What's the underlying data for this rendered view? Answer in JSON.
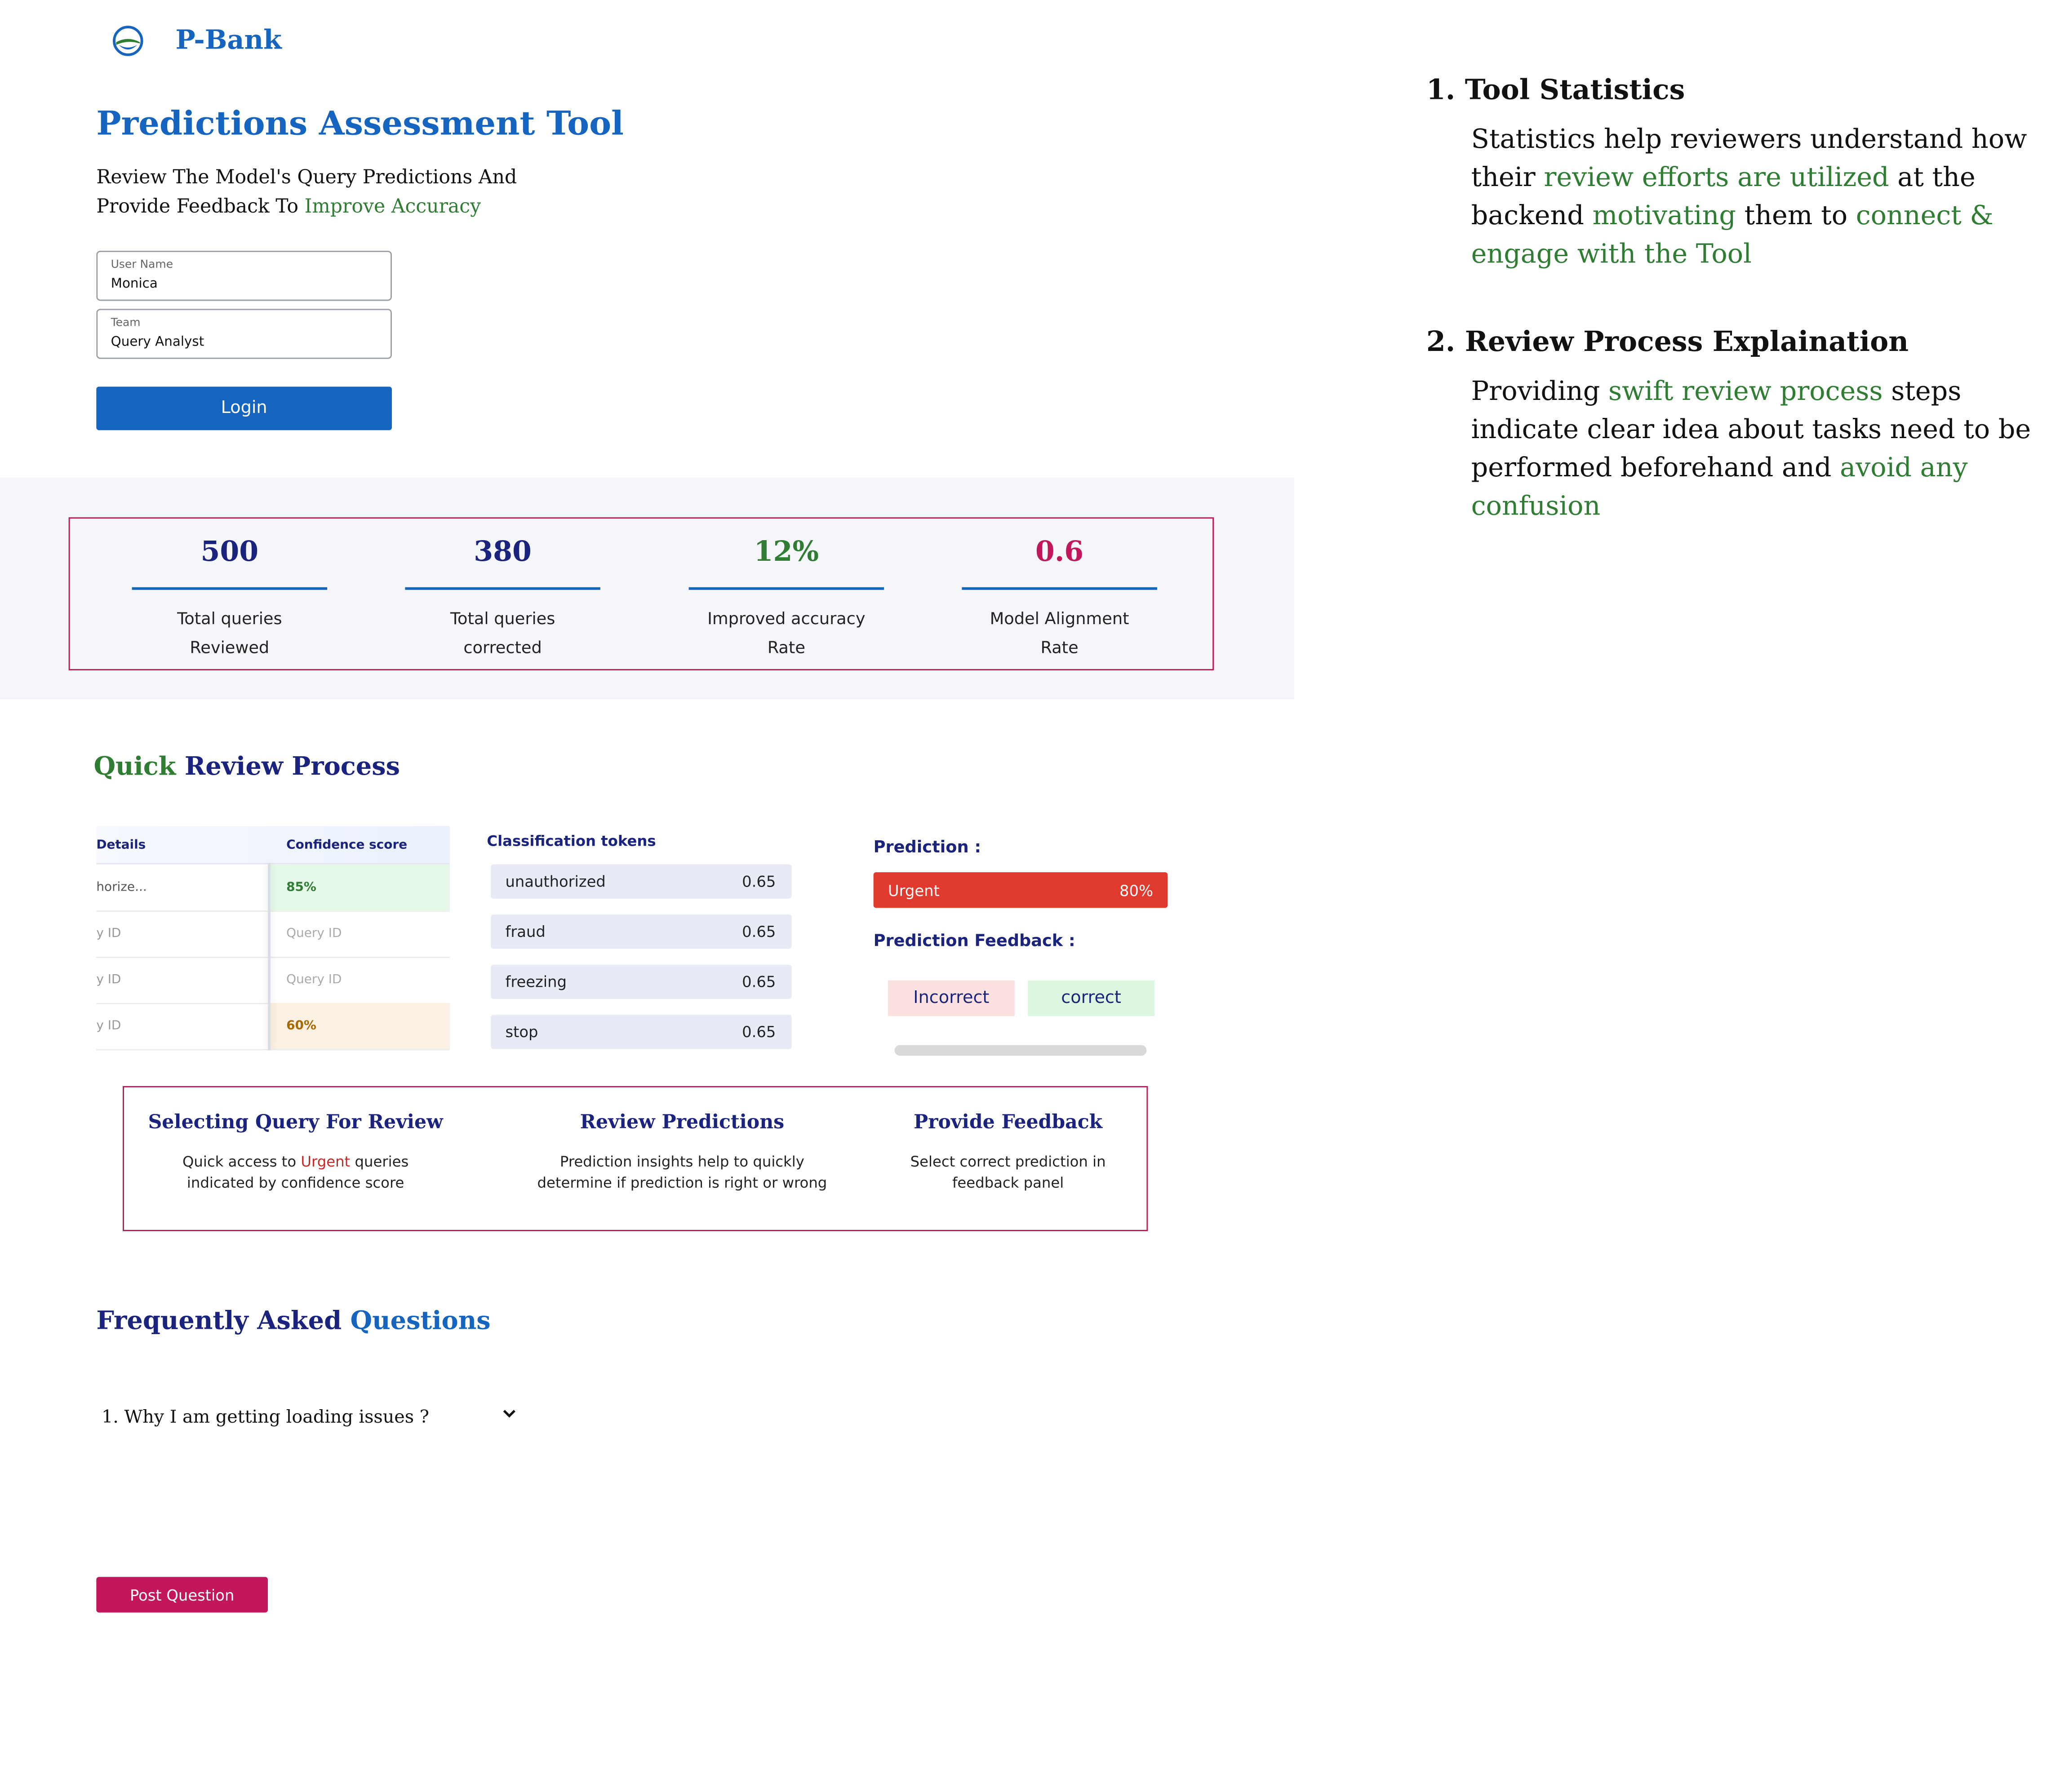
{
  "header": {
    "brand": "P-Bank",
    "logo_icon": "globe-leaf-icon"
  },
  "hero": {
    "title": "Predictions Assessment Tool",
    "subtitle_plain": "Review The Model's Query Predictions And Provide Feedback To ",
    "subtitle_highlight": "Improve Accuracy"
  },
  "login": {
    "username_label": "User Name",
    "username_value": "Monica",
    "team_label": "Team",
    "team_value": "Query Analyst",
    "button": "Login"
  },
  "stats": [
    {
      "value": "500",
      "line1": "Total queries",
      "line2": "Reviewed",
      "color": "#1a237e"
    },
    {
      "value": "380",
      "line1": "Total queries",
      "line2": "corrected",
      "color": "#1a237e"
    },
    {
      "value": "12%",
      "line1": "Improved accuracy",
      "line2": "Rate",
      "color": "#2e7d32"
    },
    {
      "value": "0.6",
      "line1": "Model Alignment",
      "line2": "Rate",
      "color": "#c2185b"
    }
  ],
  "review": {
    "title_part1": "Quick",
    "title_part2": " Review Process",
    "table": {
      "col1": "Details",
      "col2": "Confidence score",
      "rows": [
        {
          "details": "horize...",
          "score": "85%",
          "score_color": "#2e7d32",
          "bg": "#e6f9e8"
        },
        {
          "details": "y ID",
          "score": "Query ID",
          "score_color": "#aaaaaa",
          "bg": "#ffffff"
        },
        {
          "details": "y ID",
          "score": "Query ID",
          "score_color": "#aaaaaa",
          "bg": "#ffffff"
        },
        {
          "details": "y ID",
          "score": "60%",
          "score_color": "#a66a00",
          "bg": "#fbf0e4"
        }
      ]
    },
    "tokens_title": "Classification tokens",
    "tokens": [
      {
        "name": "unauthorized",
        "score": "0.65"
      },
      {
        "name": "fraud",
        "score": "0.65"
      },
      {
        "name": "freezing",
        "score": "0.65"
      },
      {
        "name": "stop",
        "score": "0.65"
      }
    ],
    "prediction_label": "Prediction :",
    "prediction_value": "Urgent",
    "prediction_percent": "80%",
    "feedback_label": "Prediction Feedback :",
    "feedback_incorrect": "Incorrect",
    "feedback_correct": "correct",
    "steps": {
      "s1_title": "Selecting Query For Review",
      "s1_a": "Quick access to ",
      "s1_hl": "Urgent",
      "s1_b": " queries",
      "s1_c": "indicated by confidence score",
      "s2_title": "Review Predictions",
      "s2_a": "Prediction insights help to quickly",
      "s2_b": "determine if prediction is right or wrong",
      "s3_title": "Provide Feedback",
      "s3_a": "Select correct prediction in",
      "s3_b": "feedback panel"
    }
  },
  "faq": {
    "title_part1": "Frequently Asked ",
    "title_part2": "Questions",
    "item1": "1. Why I am getting loading issues ?",
    "post_button": "Post Question"
  },
  "notes": {
    "n1_num": "1.",
    "n1_title": "Tool Statistics",
    "n1_a": "Statistics help reviewers understand how their ",
    "n1_hl1": "review efforts are utilized",
    "n1_b": " at the backend ",
    "n1_hl2": "motivating",
    "n1_c": " them to ",
    "n1_hl3": "connect & engage with the Tool",
    "n2_num": "2.",
    "n2_title": "Review Process Explaination",
    "n2_a": "Providing ",
    "n2_hl1": "swift review process",
    "n2_b": " steps indicate clear idea about tasks need to be performed beforehand and ",
    "n2_hl2": "avoid any confusion"
  }
}
